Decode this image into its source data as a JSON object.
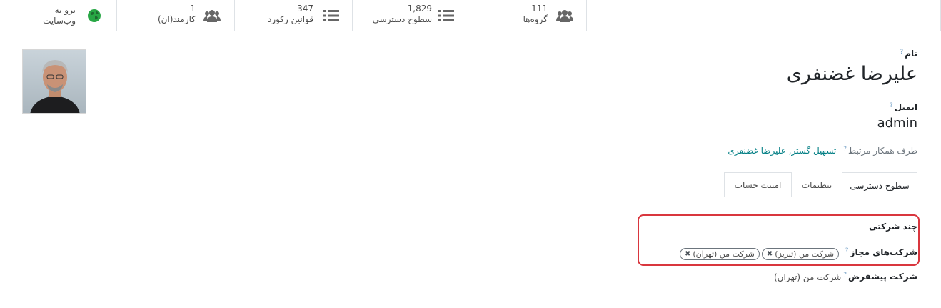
{
  "smart_buttons": {
    "website": {
      "line1": "برو به",
      "line2": "وب‌سایت"
    },
    "employees": {
      "value": "1",
      "label": "کارمند(ان)"
    },
    "record_rules": {
      "value": "347",
      "label": "قوانین رکورد"
    },
    "access_rights": {
      "value": "1,829",
      "label": "سطوح دسترسی"
    },
    "groups": {
      "value": "111",
      "label": "گروه‌ها"
    }
  },
  "form": {
    "name_label": "نام",
    "name_value": "علیرضا غضنفری",
    "email_label": "ایمیل",
    "email_value": "admin",
    "partner_label": "طرف همکار مرتبط",
    "partner_value": "تسهیل گستر, علیرضا غضنفری",
    "help_mark": "?"
  },
  "tabs": [
    {
      "label": "سطوح دسترسی",
      "active": true
    },
    {
      "label": "تنظیمات",
      "active": false
    },
    {
      "label": "امنیت حساب",
      "active": false
    }
  ],
  "multi_company": {
    "title": "چند شرکتی",
    "allowed_label": "شرکت‌های مجاز",
    "allowed_tags": [
      "شرکت من (تبریز)",
      "شرکت من (تهران)"
    ],
    "default_label": "شرکت پیشفرض",
    "default_value": "شرکت من (تهران)"
  },
  "colors": {
    "accent": "#017e84",
    "highlight": "#d9363e",
    "icon": "#666666",
    "globe": "#28a745"
  }
}
